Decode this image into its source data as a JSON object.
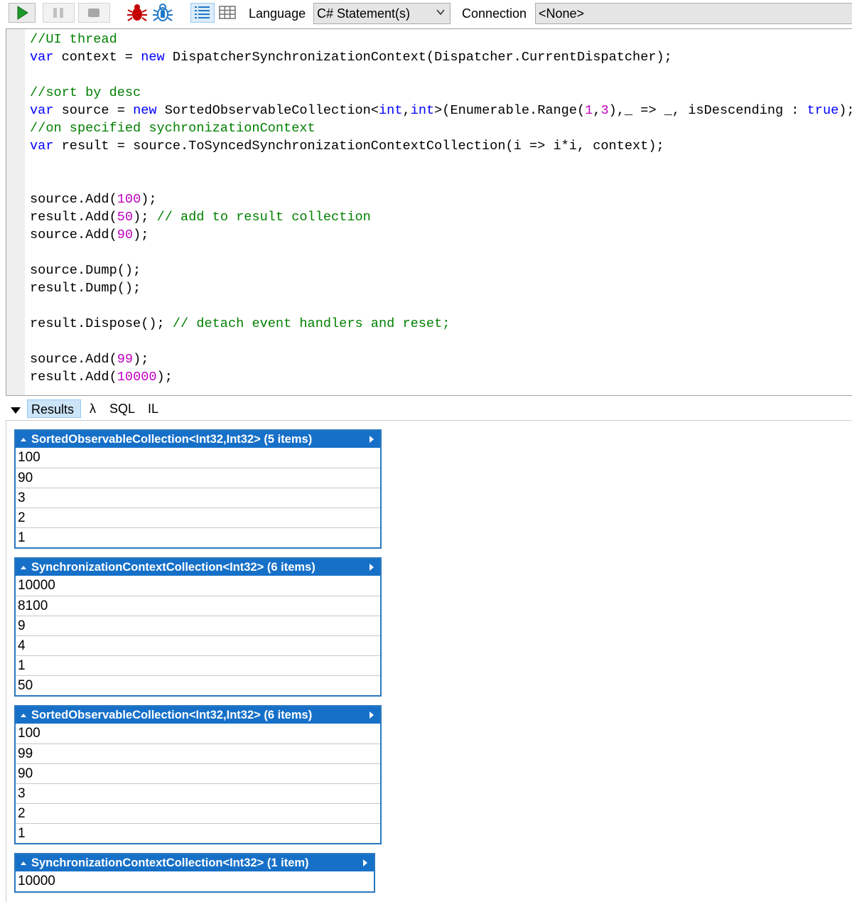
{
  "toolbar": {
    "language_label": "Language",
    "language_value": "C# Statement(s)",
    "connection_label": "Connection",
    "connection_value": "<None>"
  },
  "colors": {
    "keyword": "#0000ff",
    "comment": "#008000",
    "number": "#c000c0",
    "table_header": "#1670c8",
    "run_green": "#1f9a2a",
    "bug_red": "#c40000",
    "accent_blue": "#2a78c0"
  },
  "code_lines": [
    [
      {
        "t": "//UI thread",
        "c": "cm"
      }
    ],
    [
      {
        "t": "var",
        "c": "kw"
      },
      {
        "t": " context = "
      },
      {
        "t": "new",
        "c": "kw"
      },
      {
        "t": " DispatcherSynchronizationContext(Dispatcher.CurrentDispatcher);"
      }
    ],
    [],
    [
      {
        "t": "//sort by desc",
        "c": "cm"
      }
    ],
    [
      {
        "t": "var",
        "c": "kw"
      },
      {
        "t": " source = "
      },
      {
        "t": "new",
        "c": "kw"
      },
      {
        "t": " SortedObservableCollection<"
      },
      {
        "t": "int",
        "c": "kw"
      },
      {
        "t": ","
      },
      {
        "t": "int",
        "c": "kw"
      },
      {
        "t": ">(Enumerable.Range("
      },
      {
        "t": "1",
        "c": "num"
      },
      {
        "t": ","
      },
      {
        "t": "3",
        "c": "num"
      },
      {
        "t": "),_ => _, isDescending : "
      },
      {
        "t": "true",
        "c": "kw"
      },
      {
        "t": ");"
      }
    ],
    [
      {
        "t": "//on specified sychronizationContext",
        "c": "cm"
      }
    ],
    [
      {
        "t": "var",
        "c": "kw"
      },
      {
        "t": " result = source.ToSyncedSynchronizationContextCollection(i => i*i, context);"
      }
    ],
    [],
    [],
    [
      {
        "t": "source.Add("
      },
      {
        "t": "100",
        "c": "num"
      },
      {
        "t": ");"
      }
    ],
    [
      {
        "t": "result.Add("
      },
      {
        "t": "50",
        "c": "num"
      },
      {
        "t": "); "
      },
      {
        "t": "// add to result collection",
        "c": "cm"
      }
    ],
    [
      {
        "t": "source.Add("
      },
      {
        "t": "90",
        "c": "num"
      },
      {
        "t": ");"
      }
    ],
    [],
    [
      {
        "t": "source.Dump();"
      }
    ],
    [
      {
        "t": "result.Dump();"
      }
    ],
    [],
    [
      {
        "t": "result.Dispose(); "
      },
      {
        "t": "// detach event handlers and reset;",
        "c": "cm"
      }
    ],
    [],
    [
      {
        "t": "source.Add("
      },
      {
        "t": "99",
        "c": "num"
      },
      {
        "t": ");"
      }
    ],
    [
      {
        "t": "result.Add("
      },
      {
        "t": "10000",
        "c": "num"
      },
      {
        "t": ");"
      }
    ]
  ],
  "result_tabs": {
    "results": "Results",
    "lambda": "λ",
    "sql": "SQL",
    "il": "IL"
  },
  "results": [
    {
      "title": "SortedObservableCollection<Int32,Int32> (5 items)",
      "rows": [
        "100",
        "90",
        "3",
        "2",
        "1"
      ]
    },
    {
      "title": "SynchronizationContextCollection<Int32> (6 items)",
      "rows": [
        "10000",
        "8100",
        "9",
        "4",
        "1",
        "50"
      ]
    },
    {
      "title": "SortedObservableCollection<Int32,Int32> (6 items)",
      "rows": [
        "100",
        "99",
        "90",
        "3",
        "2",
        "1"
      ]
    },
    {
      "title": "SynchronizationContextCollection<Int32> (1 item)",
      "rows": [
        "10000"
      ]
    }
  ]
}
